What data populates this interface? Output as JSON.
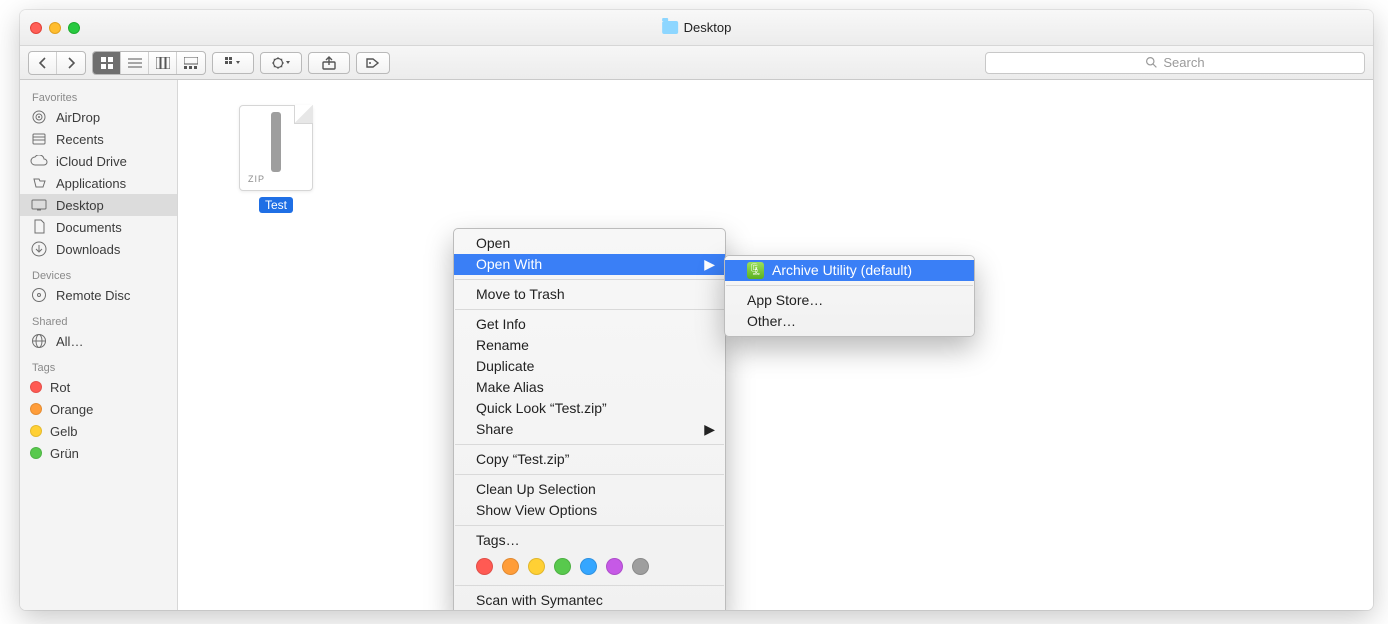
{
  "window": {
    "title": "Desktop"
  },
  "toolbar": {
    "search_placeholder": "Search"
  },
  "sidebar": {
    "sections": {
      "favorites": {
        "header": "Favorites",
        "items": [
          {
            "label": "AirDrop"
          },
          {
            "label": "Recents"
          },
          {
            "label": "iCloud Drive"
          },
          {
            "label": "Applications"
          },
          {
            "label": "Desktop",
            "selected": true
          },
          {
            "label": "Documents"
          },
          {
            "label": "Downloads"
          }
        ]
      },
      "devices": {
        "header": "Devices",
        "items": [
          {
            "label": "Remote Disc"
          }
        ]
      },
      "shared": {
        "header": "Shared",
        "items": [
          {
            "label": "All…"
          }
        ]
      },
      "tags": {
        "header": "Tags",
        "items": [
          {
            "label": "Rot",
            "color": "#ff5a53"
          },
          {
            "label": "Orange",
            "color": "#ff9d39"
          },
          {
            "label": "Gelb",
            "color": "#ffd034"
          },
          {
            "label": "Grün",
            "color": "#58c94d"
          }
        ]
      }
    }
  },
  "file": {
    "name": "Test.zip",
    "type_label": "ZIP",
    "label_truncated": "Test"
  },
  "context_menu": {
    "groups": [
      [
        "Open",
        "Open With"
      ],
      [
        "Move to Trash"
      ],
      [
        "Get Info",
        "Rename",
        "Duplicate",
        "Make Alias",
        "Quick Look “Test.zip”",
        "Share"
      ],
      [
        "Copy “Test.zip”"
      ],
      [
        "Clean Up Selection",
        "Show View Options"
      ],
      [
        "Tags…"
      ],
      [
        "Scan with Symantec"
      ]
    ],
    "highlighted": "Open With",
    "submenu_items": [
      "Archive Utility (default)",
      "App Store…",
      "Other…"
    ],
    "submenu_highlighted": "Archive Utility (default)"
  },
  "tag_palette": [
    "#ff5a53",
    "#ff9d39",
    "#ffd034",
    "#58c94d",
    "#35a6ff",
    "#c659e6",
    "#9e9e9e"
  ]
}
